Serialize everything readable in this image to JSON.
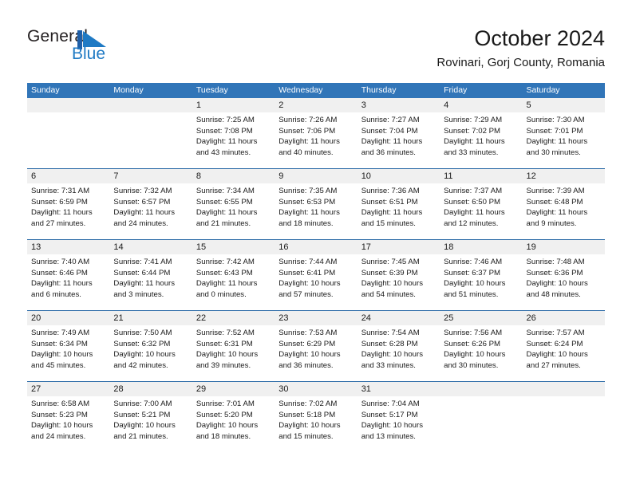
{
  "brand": {
    "name_top": "General",
    "name_bottom": "Blue",
    "flag_icon": "blue-triangle-flag-icon",
    "accent_color": "#1f7ac4"
  },
  "header": {
    "title": "October 2024",
    "subtitle": "Rovinari, Gorj County, Romania"
  },
  "theme": {
    "header_blue": "#3175b8",
    "row_divider_blue": "#2d6ca8",
    "daynum_band": "#f0f0f0",
    "text": "#1a1a1a"
  },
  "weekdays": [
    "Sunday",
    "Monday",
    "Tuesday",
    "Wednesday",
    "Thursday",
    "Friday",
    "Saturday"
  ],
  "weeks": [
    {
      "days": [
        {
          "num": "",
          "empty": true,
          "lines": [
            "",
            "",
            "",
            ""
          ]
        },
        {
          "num": "",
          "empty": true,
          "lines": [
            "",
            "",
            "",
            ""
          ]
        },
        {
          "num": "1",
          "empty": false,
          "lines": [
            "Sunrise: 7:25 AM",
            "Sunset: 7:08 PM",
            "Daylight: 11 hours",
            "and 43 minutes."
          ]
        },
        {
          "num": "2",
          "empty": false,
          "lines": [
            "Sunrise: 7:26 AM",
            "Sunset: 7:06 PM",
            "Daylight: 11 hours",
            "and 40 minutes."
          ]
        },
        {
          "num": "3",
          "empty": false,
          "lines": [
            "Sunrise: 7:27 AM",
            "Sunset: 7:04 PM",
            "Daylight: 11 hours",
            "and 36 minutes."
          ]
        },
        {
          "num": "4",
          "empty": false,
          "lines": [
            "Sunrise: 7:29 AM",
            "Sunset: 7:02 PM",
            "Daylight: 11 hours",
            "and 33 minutes."
          ]
        },
        {
          "num": "5",
          "empty": false,
          "lines": [
            "Sunrise: 7:30 AM",
            "Sunset: 7:01 PM",
            "Daylight: 11 hours",
            "and 30 minutes."
          ]
        }
      ]
    },
    {
      "days": [
        {
          "num": "6",
          "empty": false,
          "lines": [
            "Sunrise: 7:31 AM",
            "Sunset: 6:59 PM",
            "Daylight: 11 hours",
            "and 27 minutes."
          ]
        },
        {
          "num": "7",
          "empty": false,
          "lines": [
            "Sunrise: 7:32 AM",
            "Sunset: 6:57 PM",
            "Daylight: 11 hours",
            "and 24 minutes."
          ]
        },
        {
          "num": "8",
          "empty": false,
          "lines": [
            "Sunrise: 7:34 AM",
            "Sunset: 6:55 PM",
            "Daylight: 11 hours",
            "and 21 minutes."
          ]
        },
        {
          "num": "9",
          "empty": false,
          "lines": [
            "Sunrise: 7:35 AM",
            "Sunset: 6:53 PM",
            "Daylight: 11 hours",
            "and 18 minutes."
          ]
        },
        {
          "num": "10",
          "empty": false,
          "lines": [
            "Sunrise: 7:36 AM",
            "Sunset: 6:51 PM",
            "Daylight: 11 hours",
            "and 15 minutes."
          ]
        },
        {
          "num": "11",
          "empty": false,
          "lines": [
            "Sunrise: 7:37 AM",
            "Sunset: 6:50 PM",
            "Daylight: 11 hours",
            "and 12 minutes."
          ]
        },
        {
          "num": "12",
          "empty": false,
          "lines": [
            "Sunrise: 7:39 AM",
            "Sunset: 6:48 PM",
            "Daylight: 11 hours",
            "and 9 minutes."
          ]
        }
      ]
    },
    {
      "days": [
        {
          "num": "13",
          "empty": false,
          "lines": [
            "Sunrise: 7:40 AM",
            "Sunset: 6:46 PM",
            "Daylight: 11 hours",
            "and 6 minutes."
          ]
        },
        {
          "num": "14",
          "empty": false,
          "lines": [
            "Sunrise: 7:41 AM",
            "Sunset: 6:44 PM",
            "Daylight: 11 hours",
            "and 3 minutes."
          ]
        },
        {
          "num": "15",
          "empty": false,
          "lines": [
            "Sunrise: 7:42 AM",
            "Sunset: 6:43 PM",
            "Daylight: 11 hours",
            "and 0 minutes."
          ]
        },
        {
          "num": "16",
          "empty": false,
          "lines": [
            "Sunrise: 7:44 AM",
            "Sunset: 6:41 PM",
            "Daylight: 10 hours",
            "and 57 minutes."
          ]
        },
        {
          "num": "17",
          "empty": false,
          "lines": [
            "Sunrise: 7:45 AM",
            "Sunset: 6:39 PM",
            "Daylight: 10 hours",
            "and 54 minutes."
          ]
        },
        {
          "num": "18",
          "empty": false,
          "lines": [
            "Sunrise: 7:46 AM",
            "Sunset: 6:37 PM",
            "Daylight: 10 hours",
            "and 51 minutes."
          ]
        },
        {
          "num": "19",
          "empty": false,
          "lines": [
            "Sunrise: 7:48 AM",
            "Sunset: 6:36 PM",
            "Daylight: 10 hours",
            "and 48 minutes."
          ]
        }
      ]
    },
    {
      "days": [
        {
          "num": "20",
          "empty": false,
          "lines": [
            "Sunrise: 7:49 AM",
            "Sunset: 6:34 PM",
            "Daylight: 10 hours",
            "and 45 minutes."
          ]
        },
        {
          "num": "21",
          "empty": false,
          "lines": [
            "Sunrise: 7:50 AM",
            "Sunset: 6:32 PM",
            "Daylight: 10 hours",
            "and 42 minutes."
          ]
        },
        {
          "num": "22",
          "empty": false,
          "lines": [
            "Sunrise: 7:52 AM",
            "Sunset: 6:31 PM",
            "Daylight: 10 hours",
            "and 39 minutes."
          ]
        },
        {
          "num": "23",
          "empty": false,
          "lines": [
            "Sunrise: 7:53 AM",
            "Sunset: 6:29 PM",
            "Daylight: 10 hours",
            "and 36 minutes."
          ]
        },
        {
          "num": "24",
          "empty": false,
          "lines": [
            "Sunrise: 7:54 AM",
            "Sunset: 6:28 PM",
            "Daylight: 10 hours",
            "and 33 minutes."
          ]
        },
        {
          "num": "25",
          "empty": false,
          "lines": [
            "Sunrise: 7:56 AM",
            "Sunset: 6:26 PM",
            "Daylight: 10 hours",
            "and 30 minutes."
          ]
        },
        {
          "num": "26",
          "empty": false,
          "lines": [
            "Sunrise: 7:57 AM",
            "Sunset: 6:24 PM",
            "Daylight: 10 hours",
            "and 27 minutes."
          ]
        }
      ]
    },
    {
      "days": [
        {
          "num": "27",
          "empty": false,
          "lines": [
            "Sunrise: 6:58 AM",
            "Sunset: 5:23 PM",
            "Daylight: 10 hours",
            "and 24 minutes."
          ]
        },
        {
          "num": "28",
          "empty": false,
          "lines": [
            "Sunrise: 7:00 AM",
            "Sunset: 5:21 PM",
            "Daylight: 10 hours",
            "and 21 minutes."
          ]
        },
        {
          "num": "29",
          "empty": false,
          "lines": [
            "Sunrise: 7:01 AM",
            "Sunset: 5:20 PM",
            "Daylight: 10 hours",
            "and 18 minutes."
          ]
        },
        {
          "num": "30",
          "empty": false,
          "lines": [
            "Sunrise: 7:02 AM",
            "Sunset: 5:18 PM",
            "Daylight: 10 hours",
            "and 15 minutes."
          ]
        },
        {
          "num": "31",
          "empty": false,
          "lines": [
            "Sunrise: 7:04 AM",
            "Sunset: 5:17 PM",
            "Daylight: 10 hours",
            "and 13 minutes."
          ]
        },
        {
          "num": "",
          "empty": true,
          "lines": [
            "",
            "",
            "",
            ""
          ]
        },
        {
          "num": "",
          "empty": true,
          "lines": [
            "",
            "",
            "",
            ""
          ]
        }
      ]
    }
  ]
}
